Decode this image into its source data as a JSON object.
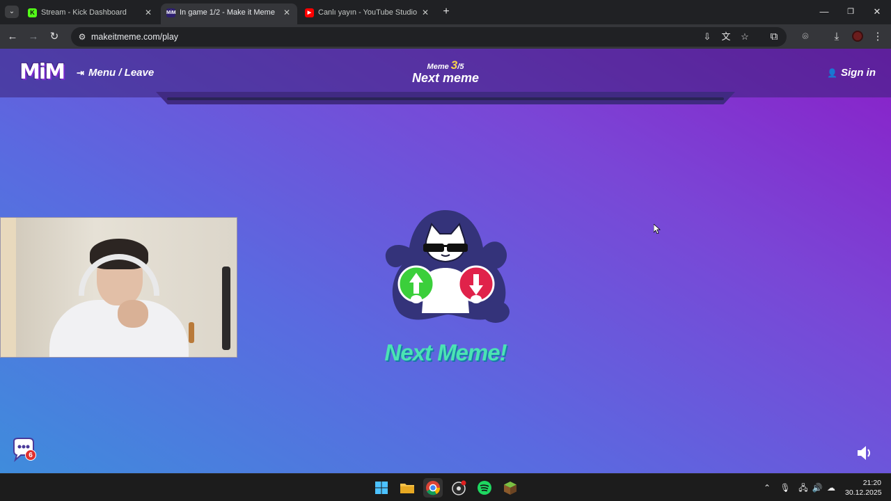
{
  "browser": {
    "tabs": [
      {
        "title": "Stream - Kick Dashboard",
        "favicon": "kick-logo"
      },
      {
        "title": "In game 1/2 - Make it Meme",
        "favicon": "mim-logo",
        "active": true
      },
      {
        "title": "Canlı yayın - YouTube Studio",
        "favicon": "youtube-logo"
      }
    ],
    "url": "makeitmeme.com/play"
  },
  "site": {
    "logo_text": "MiM",
    "menu_leave_label": "Menu / Leave",
    "round_label": "Meme",
    "round_current": "3",
    "round_total": "/5",
    "phase_title": "Next meme",
    "signin_label": "Sign in"
  },
  "main": {
    "next_meme_text": "Next Meme!",
    "chat_badge_count": "6"
  },
  "taskbar": {
    "time": "21:20",
    "date": "30.12.2025"
  },
  "colors": {
    "accent_text": "#4be3b3",
    "round_highlight": "#f7d24a",
    "upvote_green": "#3bcf3b",
    "downvote_red": "#e0224a"
  }
}
